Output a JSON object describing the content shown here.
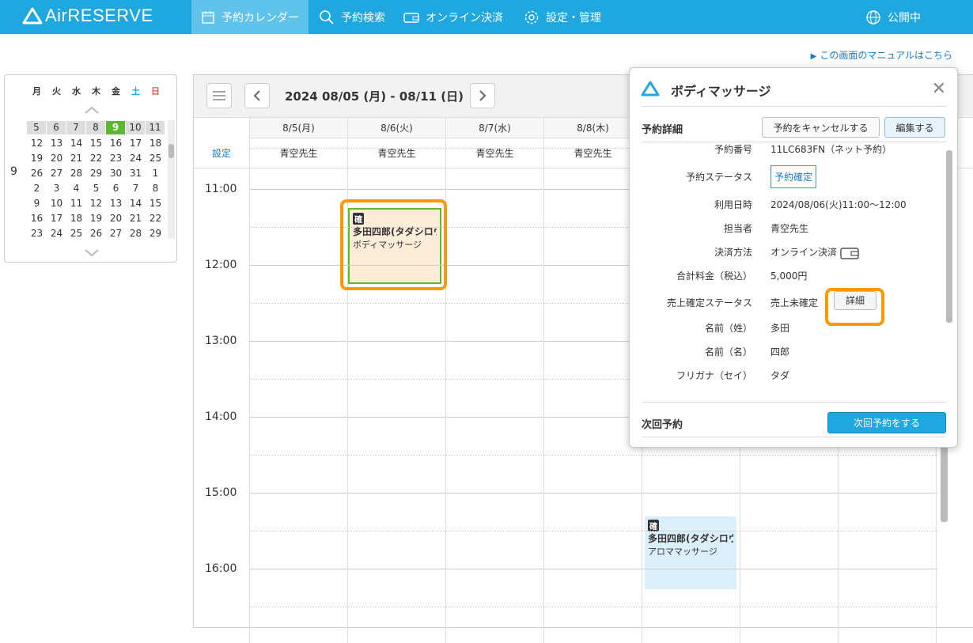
{
  "app": {
    "logo": "AirRESERVE"
  },
  "nav": {
    "calendar": "予約カレンダー",
    "search": "予約検索",
    "payment": "オンライン決済",
    "settings": "設定・管理",
    "public": "公開中"
  },
  "manual_link": "この画面のマニュアルはこちら",
  "mini_calendar": {
    "month": "9",
    "dow": [
      "月",
      "火",
      "水",
      "木",
      "金",
      "土",
      "日"
    ],
    "rows": [
      [
        "5",
        "6",
        "7",
        "8",
        "9",
        "10",
        "11"
      ],
      [
        "12",
        "13",
        "14",
        "15",
        "16",
        "17",
        "18"
      ],
      [
        "19",
        "20",
        "21",
        "22",
        "23",
        "24",
        "25"
      ],
      [
        "26",
        "27",
        "28",
        "29",
        "30",
        "31",
        "1"
      ],
      [
        "2",
        "3",
        "4",
        "5",
        "6",
        "7",
        "8"
      ],
      [
        "9",
        "10",
        "11",
        "12",
        "13",
        "14",
        "15"
      ],
      [
        "16",
        "17",
        "18",
        "19",
        "20",
        "21",
        "22"
      ],
      [
        "23",
        "24",
        "25",
        "26",
        "27",
        "28",
        "29"
      ]
    ],
    "today": "9"
  },
  "calendar": {
    "range": "2024 08/05 (月) - 08/11 (日)",
    "settings_label": "設定",
    "days": [
      "8/5(月)",
      "8/6(火)",
      "8/7(水)",
      "8/8(木)"
    ],
    "staff": [
      "青空先生",
      "青空先生",
      "青空先生",
      "青空先生"
    ],
    "times": [
      "11:00",
      "12:00",
      "13:00",
      "14:00",
      "15:00",
      "16:00"
    ]
  },
  "appointments": [
    {
      "tag": "確",
      "name": "多田四郎(タダシロウ",
      "menu": "ボディマッサージ"
    },
    {
      "tag": "確",
      "name": "多田四郎(タダシロウ",
      "menu": "アロママッサージ"
    }
  ],
  "popup": {
    "title": "ボディマッサージ",
    "section": "予約詳細",
    "cancel": "予約をキャンセルする",
    "edit": "編集する",
    "fields": [
      {
        "k": "予約番号",
        "v": "11LC683FN（ネット予約）"
      },
      {
        "k": "予約ステータス",
        "v": "予約確定"
      },
      {
        "k": "利用日時",
        "v": "2024/08/06(火)11:00〜12:00"
      },
      {
        "k": "担当者",
        "v": "青空先生"
      },
      {
        "k": "決済方法",
        "v": "オンライン決済"
      },
      {
        "k": "合計料金（税込）",
        "v": "5,000円"
      },
      {
        "k": "売上確定ステータス",
        "v": "売上未確定"
      },
      {
        "k": "名前（姓）",
        "v": "多田"
      },
      {
        "k": "名前（名）",
        "v": "四郎"
      },
      {
        "k": "フリガナ（セイ）",
        "v": "タダ"
      }
    ],
    "detail_btn": "詳細",
    "next_section": "次回予約",
    "next_btn": "次回予約をする"
  }
}
